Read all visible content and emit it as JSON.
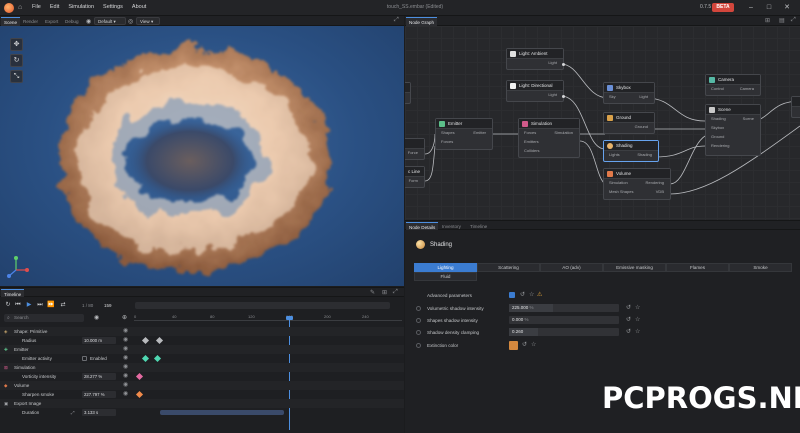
{
  "app": {
    "menu": [
      "File",
      "Edit",
      "Simulation",
      "Settings",
      "About"
    ],
    "title": "touch_SS.embar (Edited)",
    "version": "0.7.5",
    "badge": "BETA"
  },
  "viewport_tabs": [
    "Scene",
    "Render",
    "Export",
    "Debug"
  ],
  "viewport_toolbar": {
    "preset": "Default",
    "view": "View"
  },
  "node_graph": {
    "tab": "Node Graph",
    "nodes": {
      "ambient": {
        "title": "Light: Ambient",
        "ports": [
          "Light"
        ]
      },
      "directional": {
        "title": "Light: Directional",
        "ports": [
          "Light"
        ]
      },
      "skybox": {
        "title": "Skybox",
        "ports": [
          "Sky",
          "Light"
        ]
      },
      "ground": {
        "title": "Ground",
        "ports": [
          "Ground"
        ]
      },
      "camera": {
        "title": "Camera",
        "ports": [
          "Control",
          "Camera"
        ]
      },
      "scene": {
        "title": "Scene",
        "ports": [
          "Shading",
          "Scene",
          "Skybox",
          "Ground",
          "Rendering"
        ]
      },
      "emitter": {
        "title": "Emitter",
        "ports": [
          "Shapes",
          "Emitter",
          "Forces"
        ]
      },
      "simulation": {
        "title": "Simulation",
        "ports": [
          "Forces",
          "Simulation",
          "Emitters",
          "Colliders"
        ]
      },
      "shading": {
        "title": "Shading",
        "ports": [
          "Lights",
          "Shading"
        ]
      },
      "volume": {
        "title": "Volume",
        "ports": [
          "Simulation",
          "Rendering",
          "Mesh Shapes",
          "VDB"
        ]
      },
      "left_a": {
        "ports": [
          "Force"
        ]
      },
      "left_b": {
        "title": "c Line",
        "ports": [
          "Form"
        ]
      }
    }
  },
  "properties": {
    "tabs": [
      "Node Details",
      "Inventory",
      "Timeline"
    ],
    "title": "Shading",
    "segments_row1": [
      "Lighting",
      "Scattering",
      "AO (adv)",
      "Emissive masking",
      "Flames",
      "Smoke"
    ],
    "segments_row2": [
      "Fluid"
    ],
    "rows": [
      {
        "label": "Advanced parameters",
        "value": ""
      },
      {
        "label": "Volumetric shadow intensity",
        "value": "225.000",
        "unit": "%"
      },
      {
        "label": "Shapes shadow intensity",
        "value": "0.000",
        "unit": "%"
      },
      {
        "label": "Shadow density clamping",
        "value": "0.260"
      },
      {
        "label": "Extinction color",
        "value": ""
      }
    ],
    "extinction_color": "#d4883e"
  },
  "timeline": {
    "tab": "Timeline",
    "frame_start": "1 / 80",
    "frame_current": "159",
    "ruler": [
      "0",
      "40",
      "80",
      "120",
      "160",
      "200",
      "240"
    ],
    "search_placeholder": "Search",
    "tracks": [
      {
        "label": "Shape: Primitive",
        "value": ""
      },
      {
        "label": "Radius",
        "value": "10.000 m"
      },
      {
        "label": "Emitter",
        "value": ""
      },
      {
        "label": "Emitter activity",
        "value": "Enabled"
      },
      {
        "label": "Simulation",
        "value": ""
      },
      {
        "label": "Vorticity intensity",
        "value": "28.277 %"
      },
      {
        "label": "Volume",
        "value": ""
      },
      {
        "label": "Sharpen smoke",
        "value": "227.797 %"
      },
      {
        "label": "Export Image",
        "value": ""
      },
      {
        "label": "Duration",
        "value": "3.133 s"
      }
    ]
  },
  "watermark": "PCPROGS.NET"
}
